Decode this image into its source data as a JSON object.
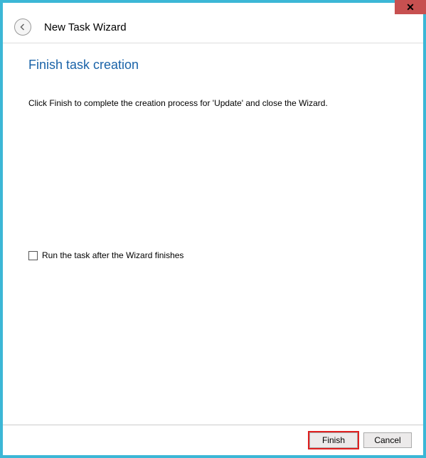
{
  "window": {
    "title": "New Task Wizard"
  },
  "page": {
    "heading": "Finish task creation",
    "instruction": "Click Finish to complete the creation process for 'Update' and close the Wizard."
  },
  "options": {
    "run_after_label": "Run the task after the Wizard finishes",
    "run_after_checked": false
  },
  "buttons": {
    "finish": "Finish",
    "cancel": "Cancel"
  }
}
